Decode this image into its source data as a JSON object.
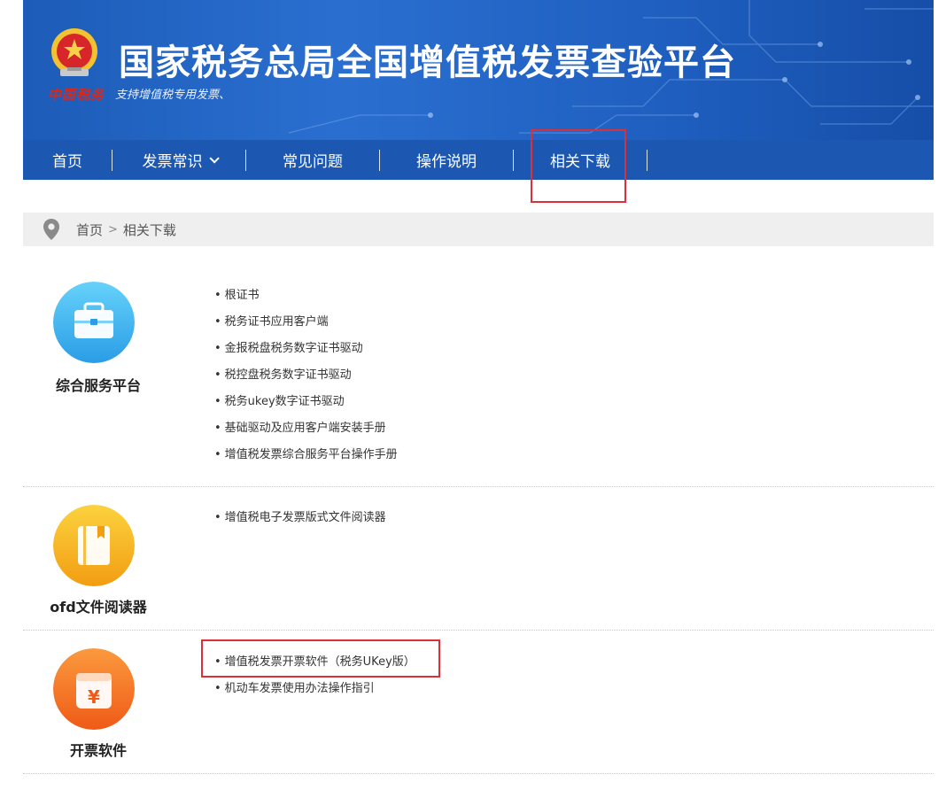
{
  "header": {
    "seal_text": "中国税务",
    "title": "国家税务总局全国增值税发票查验平台",
    "subtitle": "支持增值税专用发票、"
  },
  "nav": {
    "items": [
      {
        "label": "首页"
      },
      {
        "label": "发票常识"
      },
      {
        "label": "常见问题"
      },
      {
        "label": "操作说明"
      },
      {
        "label": "相关下载"
      }
    ]
  },
  "breadcrumb": {
    "home": "首页",
    "separator": ">",
    "current": "相关下载"
  },
  "sections": [
    {
      "title": "综合服务平台",
      "icon": "briefcase-icon",
      "color": "#3fb6ef",
      "links": [
        "根证书",
        "税务证书应用客户端",
        "金报税盘税务数字证书驱动",
        "税控盘税务数字证书驱动",
        "税务ukey数字证书驱动",
        "基础驱动及应用客户端安装手册",
        "增值税发票综合服务平台操作手册"
      ]
    },
    {
      "title": "ofd文件阅读器",
      "icon": "book-icon",
      "color": "#f7b51e",
      "links": [
        "增值税电子发票版式文件阅读器"
      ]
    },
    {
      "title": "开票软件",
      "icon": "invoice-box-icon",
      "color": "#f47a25",
      "links": [
        "增值税发票开票软件（税务UKey版）",
        "机动车发票使用办法操作指引"
      ]
    }
  ],
  "colors": {
    "banner_blue": "#1f5fc0",
    "nav_blue": "#1c58b2",
    "highlight_red": "#d9313a"
  }
}
